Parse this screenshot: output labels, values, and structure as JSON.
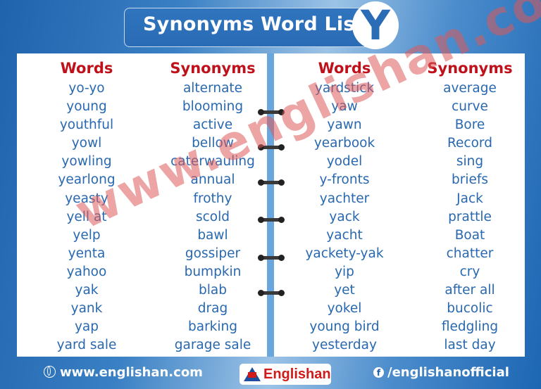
{
  "header": {
    "title": "Synonyms Word List",
    "letter": "Y"
  },
  "left_page": {
    "words_header": "Words",
    "synonyms_header": "Synonyms",
    "rows": [
      {
        "word": "yo-yo",
        "synonym": "alternate"
      },
      {
        "word": "young",
        "synonym": "blooming"
      },
      {
        "word": "youthful",
        "synonym": "active"
      },
      {
        "word": "yowl",
        "synonym": "bellow"
      },
      {
        "word": "yowling",
        "synonym": "caterwauling"
      },
      {
        "word": "yearlong",
        "synonym": "annual"
      },
      {
        "word": "yeasty",
        "synonym": "frothy"
      },
      {
        "word": "yell at",
        "synonym": "scold"
      },
      {
        "word": "yelp",
        "synonym": "bawl"
      },
      {
        "word": "yenta",
        "synonym": "gossiper"
      },
      {
        "word": "yahoo",
        "synonym": "bumpkin"
      },
      {
        "word": "yak",
        "synonym": "blab"
      },
      {
        "word": "yank",
        "synonym": "drag"
      },
      {
        "word": "yap",
        "synonym": "barking"
      },
      {
        "word": "yard sale",
        "synonym": "garage sale"
      }
    ]
  },
  "right_page": {
    "words_header": "Words",
    "synonyms_header": "Synonyms",
    "rows": [
      {
        "word": "yardstick",
        "synonym": "average"
      },
      {
        "word": "yaw",
        "synonym": "curve"
      },
      {
        "word": "yawn",
        "synonym": "Bore"
      },
      {
        "word": "yearbook",
        "synonym": "Record"
      },
      {
        "word": "yodel",
        "synonym": "sing"
      },
      {
        "word": "y-fronts",
        "synonym": "briefs"
      },
      {
        "word": "yachter",
        "synonym": "Jack"
      },
      {
        "word": "yack",
        "synonym": "prattle"
      },
      {
        "word": "yacht",
        "synonym": "Boat"
      },
      {
        "word": "yackety-yak",
        "synonym": "chatter"
      },
      {
        "word": "yip",
        "synonym": "cry"
      },
      {
        "word": "yet",
        "synonym": "after all"
      },
      {
        "word": "yokel",
        "synonym": "bucolic"
      },
      {
        "word": "young bird",
        "synonym": "fledgling"
      },
      {
        "word": "yesterday",
        "synonym": "last day"
      }
    ]
  },
  "watermark": "www.englishan.com",
  "footer": {
    "website": "www.englishan.com",
    "logo_text": "Englishan",
    "facebook": "/englishanofficial"
  },
  "colors": {
    "header_red": "#c0101a",
    "word_blue": "#2868b0",
    "brand_blue": "#2a6cb5"
  }
}
